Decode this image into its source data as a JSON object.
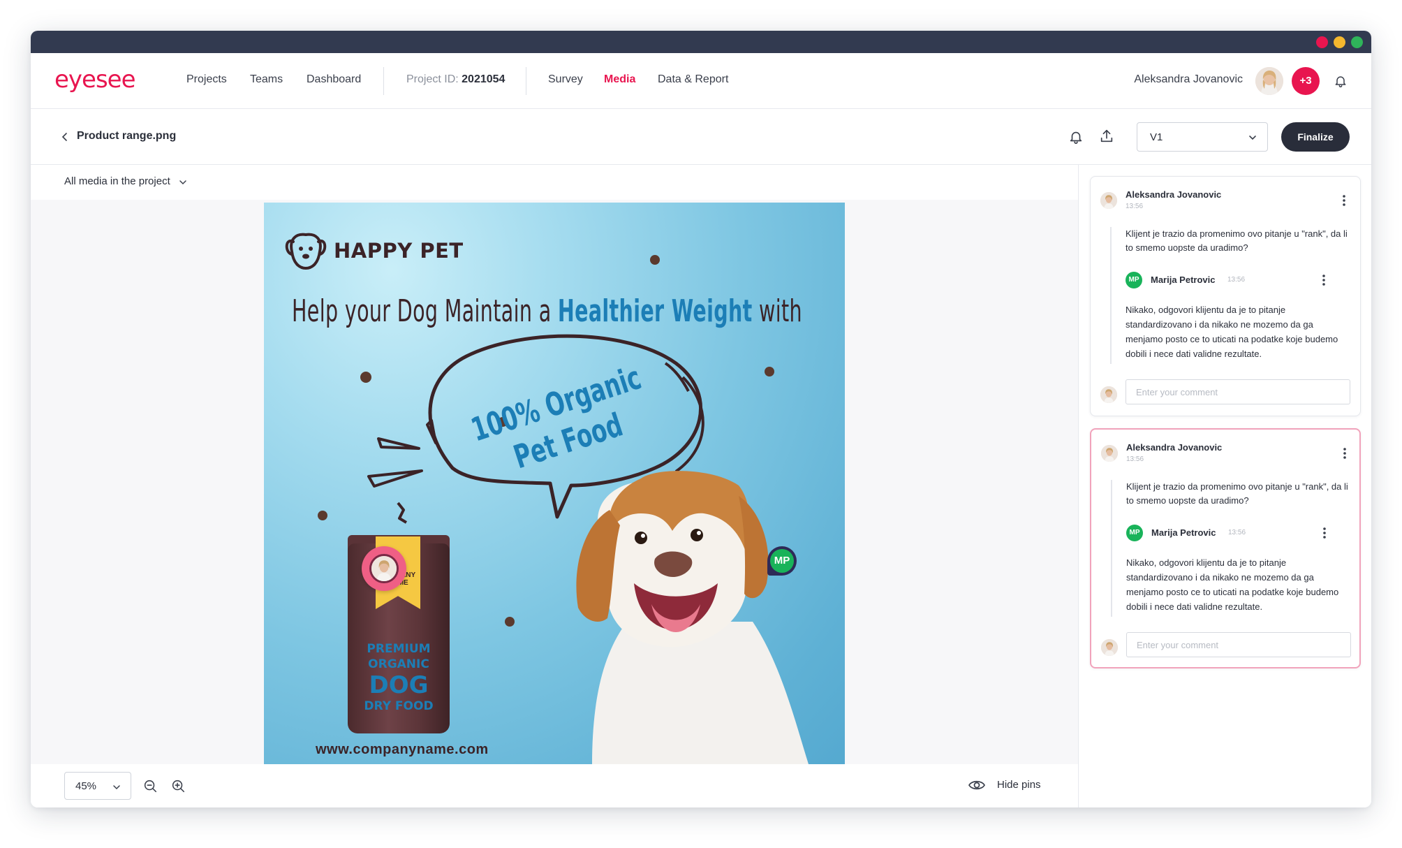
{
  "window": {
    "colors": {
      "close": "#e8154f",
      "minimize": "#f5b82e",
      "maximize": "#2fb45a",
      "titlebar": "#323a50"
    }
  },
  "nav": {
    "logo": "eyesee",
    "items": [
      {
        "label": "Projects"
      },
      {
        "label": "Teams"
      },
      {
        "label": "Dashboard"
      }
    ],
    "project_label": "Project ID:",
    "project_id": "2021054",
    "tabs": [
      {
        "label": "Survey"
      },
      {
        "label": "Media",
        "active": true
      },
      {
        "label": "Data & Report"
      }
    ],
    "user_name": "Aleksandra Jovanovic",
    "extra_users_badge": "+3",
    "accent": "#e8154f",
    "icons": [
      "bell-icon",
      "avatar"
    ]
  },
  "subheader": {
    "file_title": "Product range.png",
    "version": "V1",
    "finalize_label": "Finalize",
    "icons": [
      "chevron-left-icon",
      "bell-icon",
      "upload-icon",
      "chevron-down-icon"
    ]
  },
  "media": {
    "filter_label": "All media in the project",
    "zoom_value": "45%",
    "hide_pins_label": "Hide pins",
    "artwork": {
      "brand": "HAPPY PET",
      "headline_a": "Help your Dog Maintain a ",
      "headline_b": "Healthier Weight",
      "headline_c": " with",
      "bubble_line1": "100% Organic",
      "bubble_line2": "Pet Food",
      "bag_company_1": "COMPANY",
      "bag_company_2": "NAME",
      "bag_line1": "PREMIUM",
      "bag_line2": "ORGANIC",
      "bag_line3": "DOG",
      "bag_line4": "DRY FOOD",
      "url": "www.companyname.com"
    },
    "pins": [
      {
        "type": "user-avatar"
      },
      {
        "type": "initials",
        "label": "MP"
      }
    ]
  },
  "comments": [
    {
      "author": "Aleksandra Jovanovic",
      "time": "13:56",
      "text": "Klijent je trazio da promenimo ovo pitanje u \"rank\", da li to smemo uopste da uradimo?",
      "reply": {
        "initials": "MP",
        "author": "Marija Petrovic",
        "time": "13:56",
        "text": "Nikako, odgovori klijentu da je to pitanje standardizovano i da nikako ne mozemo da ga menjamo posto ce to uticati na podatke koje budemo dobili i nece dati validne rezultate."
      },
      "input_placeholder": "Enter your comment"
    },
    {
      "author": "Aleksandra Jovanovic",
      "time": "13:56",
      "text": "Klijent je trazio da promenimo ovo pitanje u \"rank\", da li to smemo uopste da uradimo?",
      "reply": {
        "initials": "MP",
        "author": "Marija Petrovic",
        "time": "13:56",
        "text": "Nikako, odgovori klijentu da je to pitanje standardizovano i da nikako ne mozemo da ga menjamo posto ce to uticati na podatke koje budemo dobili i nece dati validne rezultate."
      },
      "input_placeholder": "Enter your comment",
      "active": true
    }
  ]
}
